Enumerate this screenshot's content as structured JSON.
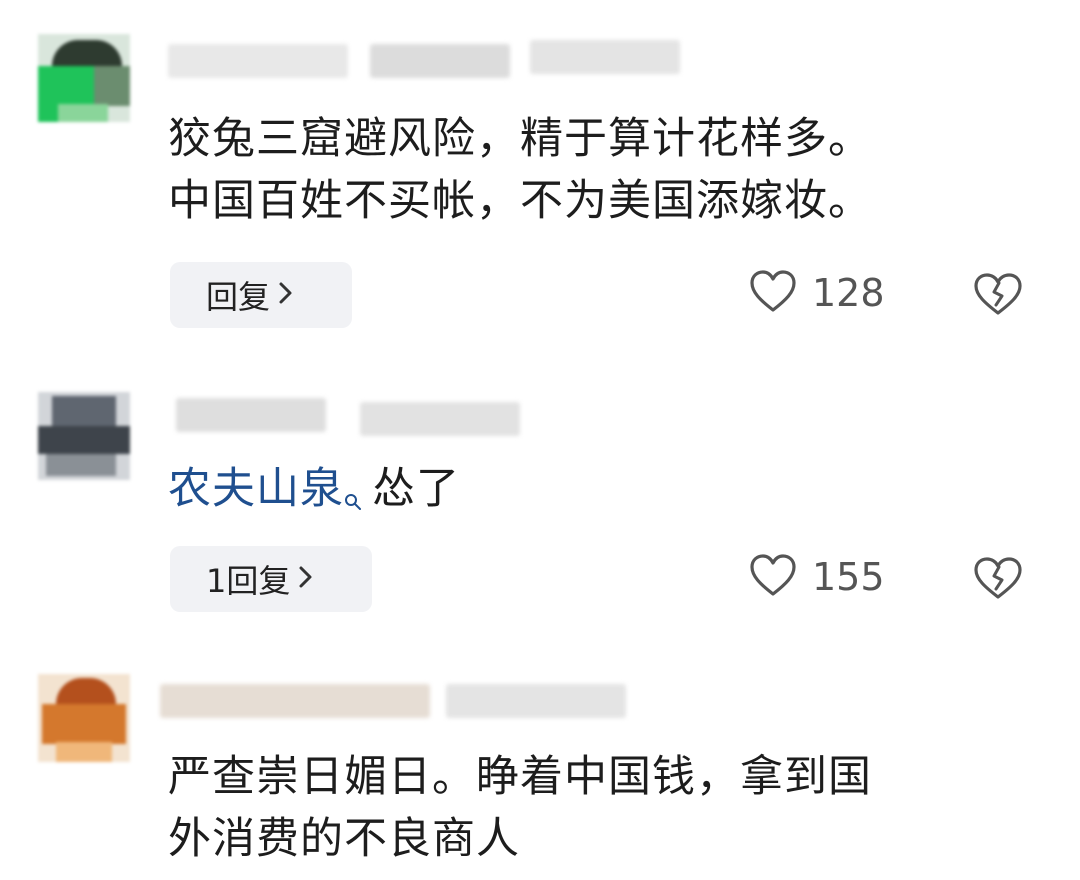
{
  "comments": [
    {
      "text_lines": [
        "狡兔三窟避风险，精于算计花样多。",
        "中国百姓不买帐，不为美国添嫁妆。"
      ],
      "reply_label": "回复",
      "like_count": "128",
      "avatar_colors": [
        "#1fc35a",
        "#3a6b3f",
        "#8ad59a"
      ]
    },
    {
      "mention": "农夫山泉",
      "text_after": "怂了",
      "reply_label": "1回复",
      "like_count": "155",
      "avatar_colors": [
        "#5f6670",
        "#8a9096",
        "#3e444b"
      ]
    },
    {
      "text_lines": [
        "严查崇日媚日。睁着中国钱，拿到国",
        "外消费的不良商人"
      ],
      "avatar_colors": [
        "#d4782d",
        "#b4501d",
        "#f0b77a"
      ]
    }
  ],
  "icons": {
    "like": "heart-outline-icon",
    "dislike": "broken-heart-icon",
    "mention": "search-icon",
    "chevron": "chevron-right-icon"
  }
}
